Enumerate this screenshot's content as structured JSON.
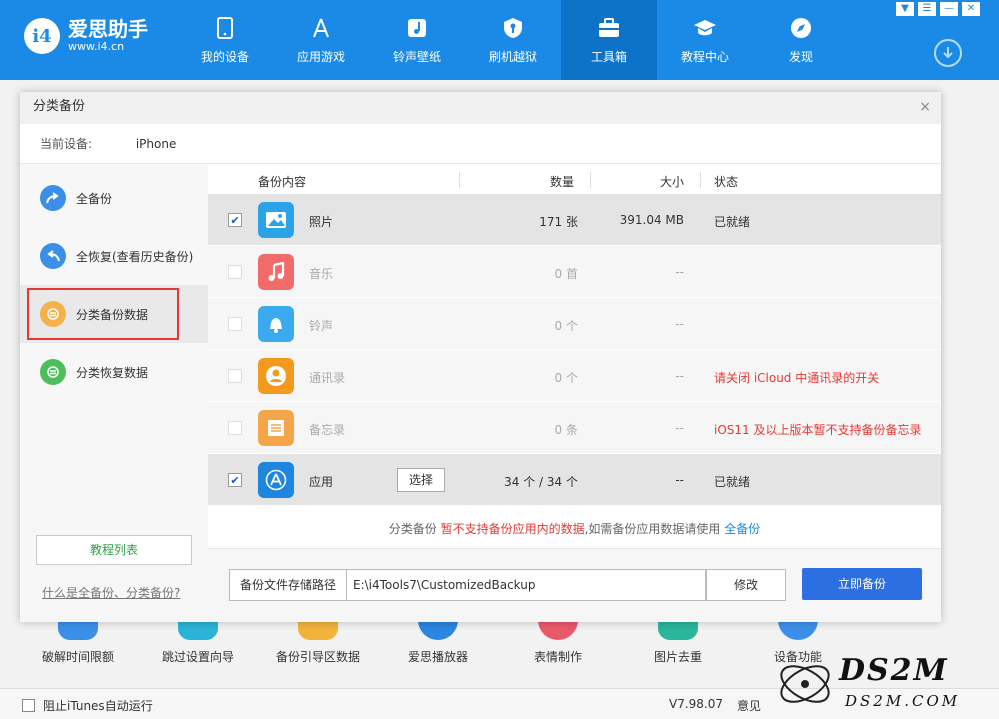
{
  "app": {
    "logo_mark": "i4",
    "logo_name": "爱思助手",
    "logo_url": "www.i4.cn",
    "nav": [
      {
        "label": "我的设备",
        "icon": "phone-icon"
      },
      {
        "label": "应用游戏",
        "icon": "app-store-icon"
      },
      {
        "label": "铃声壁纸",
        "icon": "music-note-icon"
      },
      {
        "label": "刷机越狱",
        "icon": "shield-key-icon"
      },
      {
        "label": "工具箱",
        "icon": "toolbox-icon",
        "active": true
      },
      {
        "label": "教程中心",
        "icon": "graduation-cap-icon"
      },
      {
        "label": "发现",
        "icon": "compass-icon"
      }
    ],
    "window_controls": [
      "▼",
      "☰",
      "—",
      "✕"
    ]
  },
  "background_tools": [
    {
      "label": "破解时间限额"
    },
    {
      "label": "跳过设置向导"
    },
    {
      "label": "备份引导区数据"
    },
    {
      "label": "爱思播放器"
    },
    {
      "label": "表情制作"
    },
    {
      "label": "图片去重"
    },
    {
      "label": "设备功能"
    }
  ],
  "footer": {
    "itunes_label": "阻止iTunes自动运行",
    "version": "V7.98.07",
    "feedback": "意见"
  },
  "watermark": {
    "big": "DS2M",
    "small": "DS2M.COM"
  },
  "dialog": {
    "title": "分类备份",
    "close": "×",
    "device_label": "当前设备:",
    "device_name": "iPhone",
    "menu": [
      {
        "label": "全备份",
        "color": "#3b8fe8"
      },
      {
        "label": "全恢复(查看历史备份)",
        "color": "#3b8fe8"
      },
      {
        "label": "分类备份数据",
        "color": "#f5b24a",
        "selected": true
      },
      {
        "label": "分类恢复数据",
        "color": "#4cbf5a"
      }
    ],
    "tutorial_button": "教程列表",
    "help_link": "什么是全备份、分类备份?",
    "columns": {
      "content": "备份内容",
      "qty": "数量",
      "size": "大小",
      "status": "状态"
    },
    "rows": [
      {
        "name": "照片",
        "qty": "171 张",
        "size": "391.04 MB",
        "status": "已就绪",
        "checked": true,
        "enabled": true,
        "icon_color": "#2aa3e8",
        "icon": "photo-icon"
      },
      {
        "name": "音乐",
        "qty": "0 首",
        "size": "--",
        "status": "",
        "checked": false,
        "enabled": false,
        "icon_color": "#f26b6b",
        "icon": "music-icon"
      },
      {
        "name": "铃声",
        "qty": "0 个",
        "size": "--",
        "status": "",
        "checked": false,
        "enabled": false,
        "icon_color": "#3ba9ee",
        "icon": "bell-icon"
      },
      {
        "name": "通讯录",
        "qty": "0 个",
        "size": "--",
        "status": "请关闭 iCloud 中通讯录的开关",
        "checked": false,
        "enabled": false,
        "icon_color": "#f39a1e",
        "icon": "contact-icon"
      },
      {
        "name": "备忘录",
        "qty": "0 条",
        "size": "--",
        "status": "iOS11 及以上版本暂不支持备份备忘录",
        "checked": false,
        "enabled": false,
        "icon_color": "#f4a54a",
        "icon": "notes-icon"
      },
      {
        "name": "应用",
        "qty": "34 个 / 34 个",
        "size": "--",
        "status": "已就绪",
        "checked": true,
        "enabled": true,
        "icon_color": "#1f86e0",
        "icon": "app-store-icon",
        "select_button": "选择"
      }
    ],
    "notice": {
      "prefix": "分类备份 ",
      "warning": "暂不支持备份应用内的数据",
      "middle": ",如需备份应用数据请使用 ",
      "link": "全备份"
    },
    "path_label": "备份文件存储路径",
    "path_value": "E:\\i4Tools7\\CustomizedBackup",
    "modify_button": "修改",
    "backup_button": "立即备份"
  }
}
